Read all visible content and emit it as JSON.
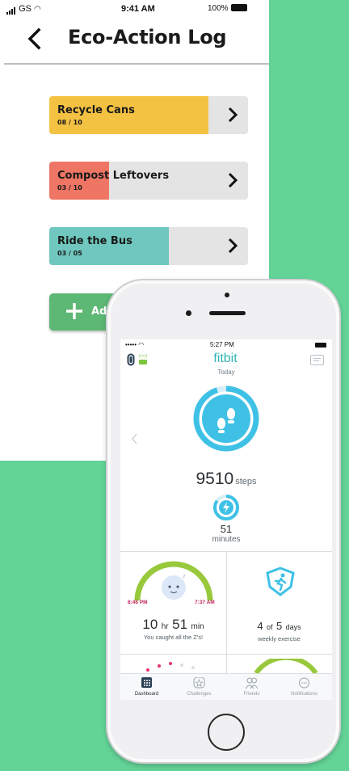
{
  "eco_screen": {
    "status": {
      "carrier": "GS",
      "time": "9:41 AM",
      "battery": "100%"
    },
    "title": "Eco-Action Log",
    "tasks": [
      {
        "name": "Recycle Cans",
        "count": "08 / 10",
        "progress": 0.8,
        "color": "#f4c242"
      },
      {
        "name": "Compost Leftovers",
        "count": "03 / 10",
        "progress": 0.3,
        "color": "#ef7564"
      },
      {
        "name": "Ride the Bus",
        "count": "03 / 05",
        "progress": 0.6,
        "color": "#6fc7bf"
      }
    ],
    "add_button": {
      "label": "Add Action",
      "icon": "plus-icon",
      "color": "#5db775"
    }
  },
  "fitbit_screen": {
    "status": {
      "carrier": "•••••",
      "time": "5:27 PM"
    },
    "brand": "fitbit",
    "day": "Today",
    "steps": {
      "value": "9510",
      "unit": "steps",
      "goal_fraction": 0.95
    },
    "active_minutes": {
      "value": "51",
      "unit": "minutes",
      "goal_fraction": 0.85
    },
    "sleep": {
      "start": "8:46 PM",
      "end": "7:37 AM",
      "hours": "10",
      "hours_unit": "hr",
      "minutes": "51",
      "minutes_unit": "min",
      "message": "You caught all the Z's!"
    },
    "exercise": {
      "done": "4",
      "of": "of",
      "goal": "5",
      "unit": "days",
      "message": "weekly exercise"
    },
    "tabs": [
      {
        "label": "Dashboard",
        "icon": "dashboard-icon",
        "active": true
      },
      {
        "label": "Challenges",
        "icon": "challenges-star-icon",
        "active": false
      },
      {
        "label": "Friends",
        "icon": "friends-icon",
        "active": false
      },
      {
        "label": "Notifications",
        "icon": "notifications-chat-icon",
        "active": false
      }
    ],
    "accent": "#3fc1e6",
    "sleep_accent": "#98c83b"
  }
}
